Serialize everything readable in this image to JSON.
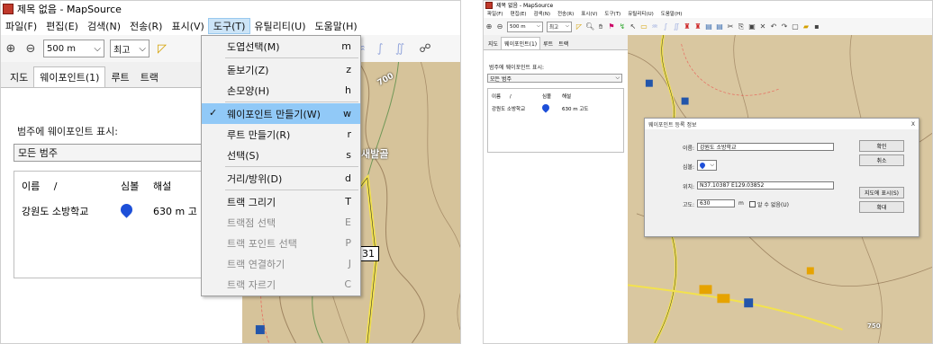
{
  "left": {
    "window": {
      "title": "제목 없음 - MapSource"
    },
    "menubar": [
      "파일(F)",
      "편집(E)",
      "검색(N)",
      "전송(R)",
      "표시(V)",
      "도구(T)",
      "유틸리티(U)",
      "도움말(H)"
    ],
    "toolbar": {
      "zoom_value": "500 m",
      "detail_value": "최고"
    },
    "tabs": [
      "지도",
      "웨이포인트(1)",
      "루트",
      "트랙"
    ],
    "category_label": "범주에 웨이포인트 표시:",
    "category_value": "모든 범주",
    "list": {
      "headers": {
        "name": "이름",
        "sort_mark": "/",
        "symbol": "심볼",
        "comment": "해설"
      },
      "rows": [
        {
          "name": "강원도 소방학교",
          "comment": "630 m 고"
        }
      ]
    },
    "dropdown": [
      {
        "label": "도엽선택(M)",
        "shortcut": "m",
        "disabled": false
      },
      {
        "separator": true
      },
      {
        "label": "돋보기(Z)",
        "shortcut": "z",
        "disabled": false
      },
      {
        "label": "손모양(H)",
        "shortcut": "h",
        "disabled": false
      },
      {
        "separator": true
      },
      {
        "label": "웨이포인트 만들기(W)",
        "shortcut": "w",
        "checked": true,
        "highlighted": true
      },
      {
        "label": "루트 만들기(R)",
        "shortcut": "r",
        "disabled": false
      },
      {
        "label": "선택(S)",
        "shortcut": "s",
        "disabled": false
      },
      {
        "separator": true
      },
      {
        "label": "거리/방위(D)",
        "shortcut": "d",
        "disabled": false
      },
      {
        "separator": true
      },
      {
        "label": "트랙 그리기",
        "shortcut": "T",
        "disabled": false
      },
      {
        "label": "트랙점 선택",
        "shortcut": "E",
        "disabled": true
      },
      {
        "label": "트랙 포인트 선택",
        "shortcut": "P",
        "disabled": true
      },
      {
        "label": "트랙 연결하기",
        "shortcut": "J",
        "disabled": true
      },
      {
        "label": "트랙 자르기",
        "shortcut": "C",
        "disabled": true
      }
    ],
    "map": {
      "contour_label": "700",
      "place_label": "새발골",
      "route_number": "31"
    }
  },
  "right": {
    "window": {
      "title": "제목 없음 - MapSource"
    },
    "menubar": [
      "파일(F)",
      "편집(E)",
      "검색(N)",
      "전송(R)",
      "표시(V)",
      "도구(T)",
      "유틸리티(U)",
      "도움말(H)"
    ],
    "toolbar": {
      "zoom_value": "500 m",
      "detail_value": "최고"
    },
    "tabs": [
      "지도",
      "웨이포인트(1)",
      "루트",
      "트랙"
    ],
    "category_label": "범주에 웨이포인트 표시:",
    "category_value": "모든 범주",
    "list": {
      "headers": {
        "name": "이름",
        "sort_mark": "/",
        "symbol": "심볼",
        "comment": "해설"
      },
      "rows": [
        {
          "name": "강원도 소방학교",
          "comment": "630 m 고도"
        }
      ]
    },
    "dialog": {
      "title": "웨이포인트 등록 정보",
      "close": "X",
      "name_label": "이름:",
      "name_value": "강원도 소방학교",
      "symbol_label": "심볼:",
      "position_label": "위치:",
      "position_value": "N37.10387 E129.03852",
      "altitude_label": "고도:",
      "altitude_value": "630",
      "altitude_unit": "m",
      "unknown_label": "알 수 없음(U)",
      "buttons": {
        "ok": "확인",
        "cancel": "취소",
        "show_map": "지도에 표시(S)",
        "zoom": "확대"
      }
    },
    "map": {
      "contour_label": "750"
    }
  }
}
